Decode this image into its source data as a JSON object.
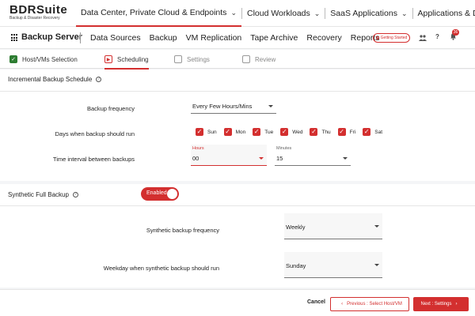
{
  "app": {
    "logo_main": "BDRSuite",
    "logo_sub": "Backup & Disaster Recovery"
  },
  "topnav": [
    {
      "label": "Data Center, Private Cloud & Endpoints",
      "icon": "chevron-down-icon"
    },
    {
      "label": "Cloud Workloads",
      "icon": "chevron-down-icon"
    },
    {
      "label": "SaaS Applications",
      "icon": "chevron-down-icon"
    },
    {
      "label": "Applications & DBs",
      "icon": "chevron-down-icon"
    }
  ],
  "subbar": {
    "product": "Backup Server",
    "menu": [
      "Data Sources",
      "Backup",
      "VM Replication",
      "Tape Archive",
      "Recovery",
      "Reports"
    ],
    "getting_started": "Getting Started",
    "notification_count": "36",
    "help_glyph": "?"
  },
  "steps": [
    {
      "label": "Host/VMs Selection",
      "state": "done",
      "glyph": "✓"
    },
    {
      "label": "Scheduling",
      "state": "current",
      "glyph": "▶"
    },
    {
      "label": "Settings",
      "state": "pending",
      "glyph": ""
    },
    {
      "label": "Review",
      "state": "pending",
      "glyph": ""
    }
  ],
  "incremental": {
    "title": "Incremental Backup Schedule",
    "help_glyph": "?",
    "frequency_label": "Backup frequency",
    "frequency_value": "Every Few Hours/Mins",
    "days_label": "Days when backup should run",
    "days": [
      "Sun",
      "Mon",
      "Tue",
      "Wed",
      "Thu",
      "Fri",
      "Sat"
    ],
    "check_glyph": "✓",
    "interval_label": "Time interval between backups",
    "hours_label": "Hours",
    "hours_value": "00",
    "minutes_label": "Minutes",
    "minutes_value": "15"
  },
  "synthetic": {
    "title": "Synthetic Full Backup",
    "help_glyph": "?",
    "toggle_label": "Enabled",
    "frequency_label": "Synthetic backup frequency",
    "frequency_value": "Weekly",
    "weekday_label": "Weekday when synthetic backup should run",
    "weekday_value": "Sunday"
  },
  "footer": {
    "cancel": "Cancel",
    "previous": "Previous : Select Host/VM",
    "next": "Next : Settings"
  },
  "colors": {
    "accent": "#d32f2f",
    "success": "#2e7d32"
  }
}
